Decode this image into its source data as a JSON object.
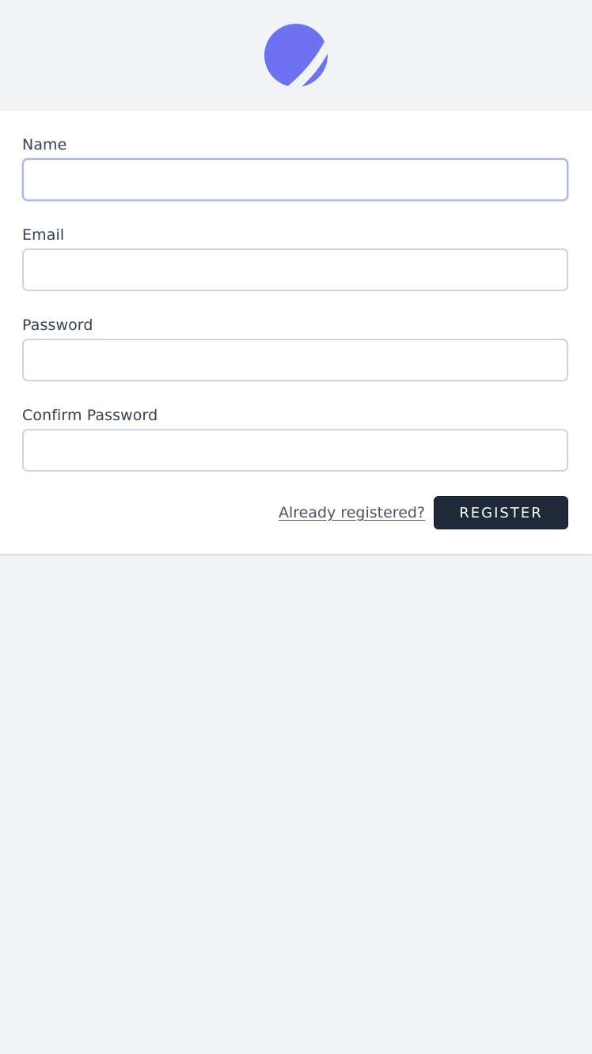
{
  "brand": {
    "logo_icon": "app-logo-icon",
    "accent_color": "#6d72f0"
  },
  "form": {
    "name": {
      "label": "Name",
      "value": "",
      "placeholder": ""
    },
    "email": {
      "label": "Email",
      "value": "",
      "placeholder": ""
    },
    "password": {
      "label": "Password",
      "value": "",
      "placeholder": ""
    },
    "confirm_password": {
      "label": "Confirm Password",
      "value": "",
      "placeholder": ""
    }
  },
  "actions": {
    "login_link_label": "Already registered?",
    "register_label": "REGISTER"
  }
}
